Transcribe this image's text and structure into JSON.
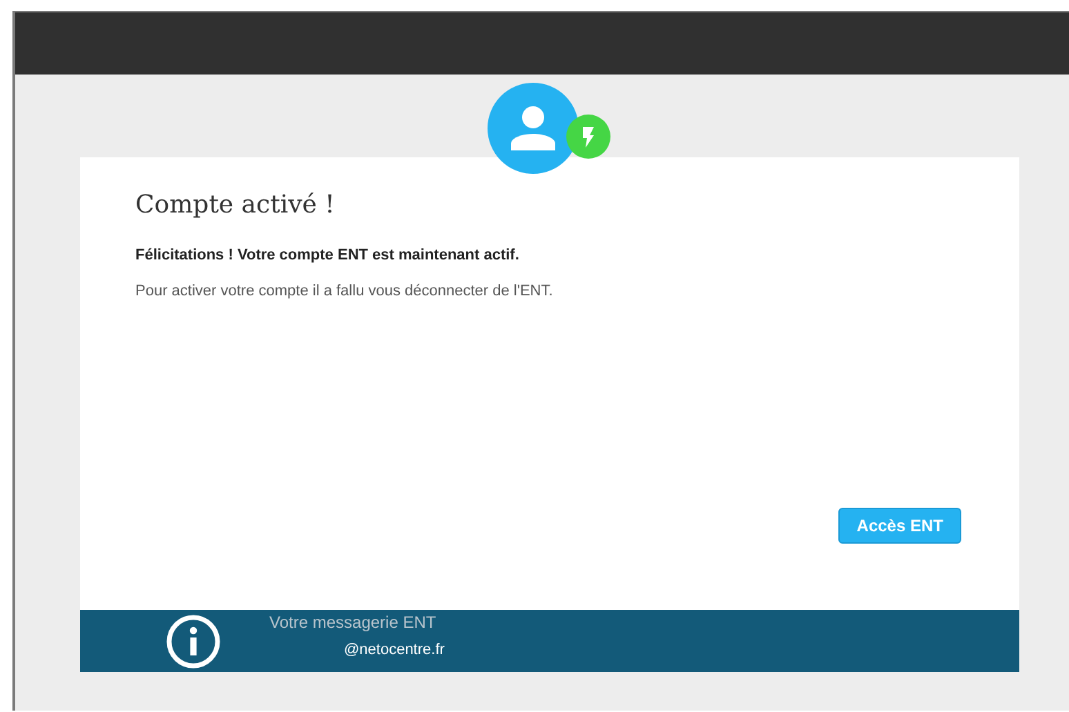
{
  "card": {
    "title": "Compte activé !",
    "message": "Félicitations ! Votre compte ENT est maintenant actif.",
    "note": "Pour activer votre compte il a fallu vous déconnecter de l'ENT.",
    "button": "Accès ENT"
  },
  "footer": {
    "title": "Votre messagerie ENT",
    "address": "@netocentre.fr"
  }
}
